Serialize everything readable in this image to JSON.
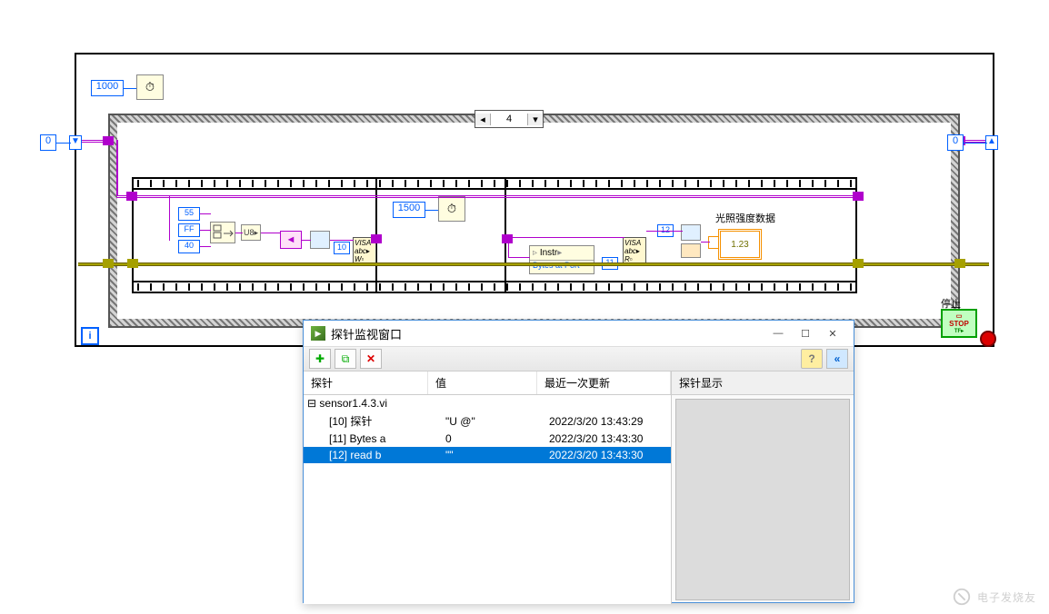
{
  "diagram": {
    "timer_const": "1000",
    "frame_const": "1500",
    "iteration_left": "0",
    "iteration_right": "0",
    "case_value": "4",
    "hex_consts": [
      "55",
      "FF",
      "40"
    ],
    "probe_label_10": "10",
    "probe_label_11": "11",
    "probe_label_12": "12",
    "visa_bytes_label": "Bytes at Port",
    "instr_label": "Instr",
    "output_label": "光照强度数据",
    "numeric_display": "1.23",
    "stop_label": "停止",
    "stop_btn": "STOP"
  },
  "probe_window": {
    "title": "探针监视窗口",
    "min": "—",
    "max": "☐",
    "close": "✕",
    "columns": {
      "probe": "探针",
      "value": "值",
      "time": "最近一次更新"
    },
    "right_header": "探针显示",
    "tree_root": "sensor1.4.3.vi",
    "rows": [
      {
        "name": "[10] 探针",
        "value": "\"U   @\"",
        "time": "2022/3/20 13:43:29",
        "selected": false
      },
      {
        "name": "[11] Bytes a",
        "value": "0",
        "time": "2022/3/20 13:43:30",
        "selected": false
      },
      {
        "name": "[12] read b",
        "value": "\"\"",
        "time": "2022/3/20 13:43:30",
        "selected": true
      }
    ]
  },
  "watermark": "电子发烧友"
}
